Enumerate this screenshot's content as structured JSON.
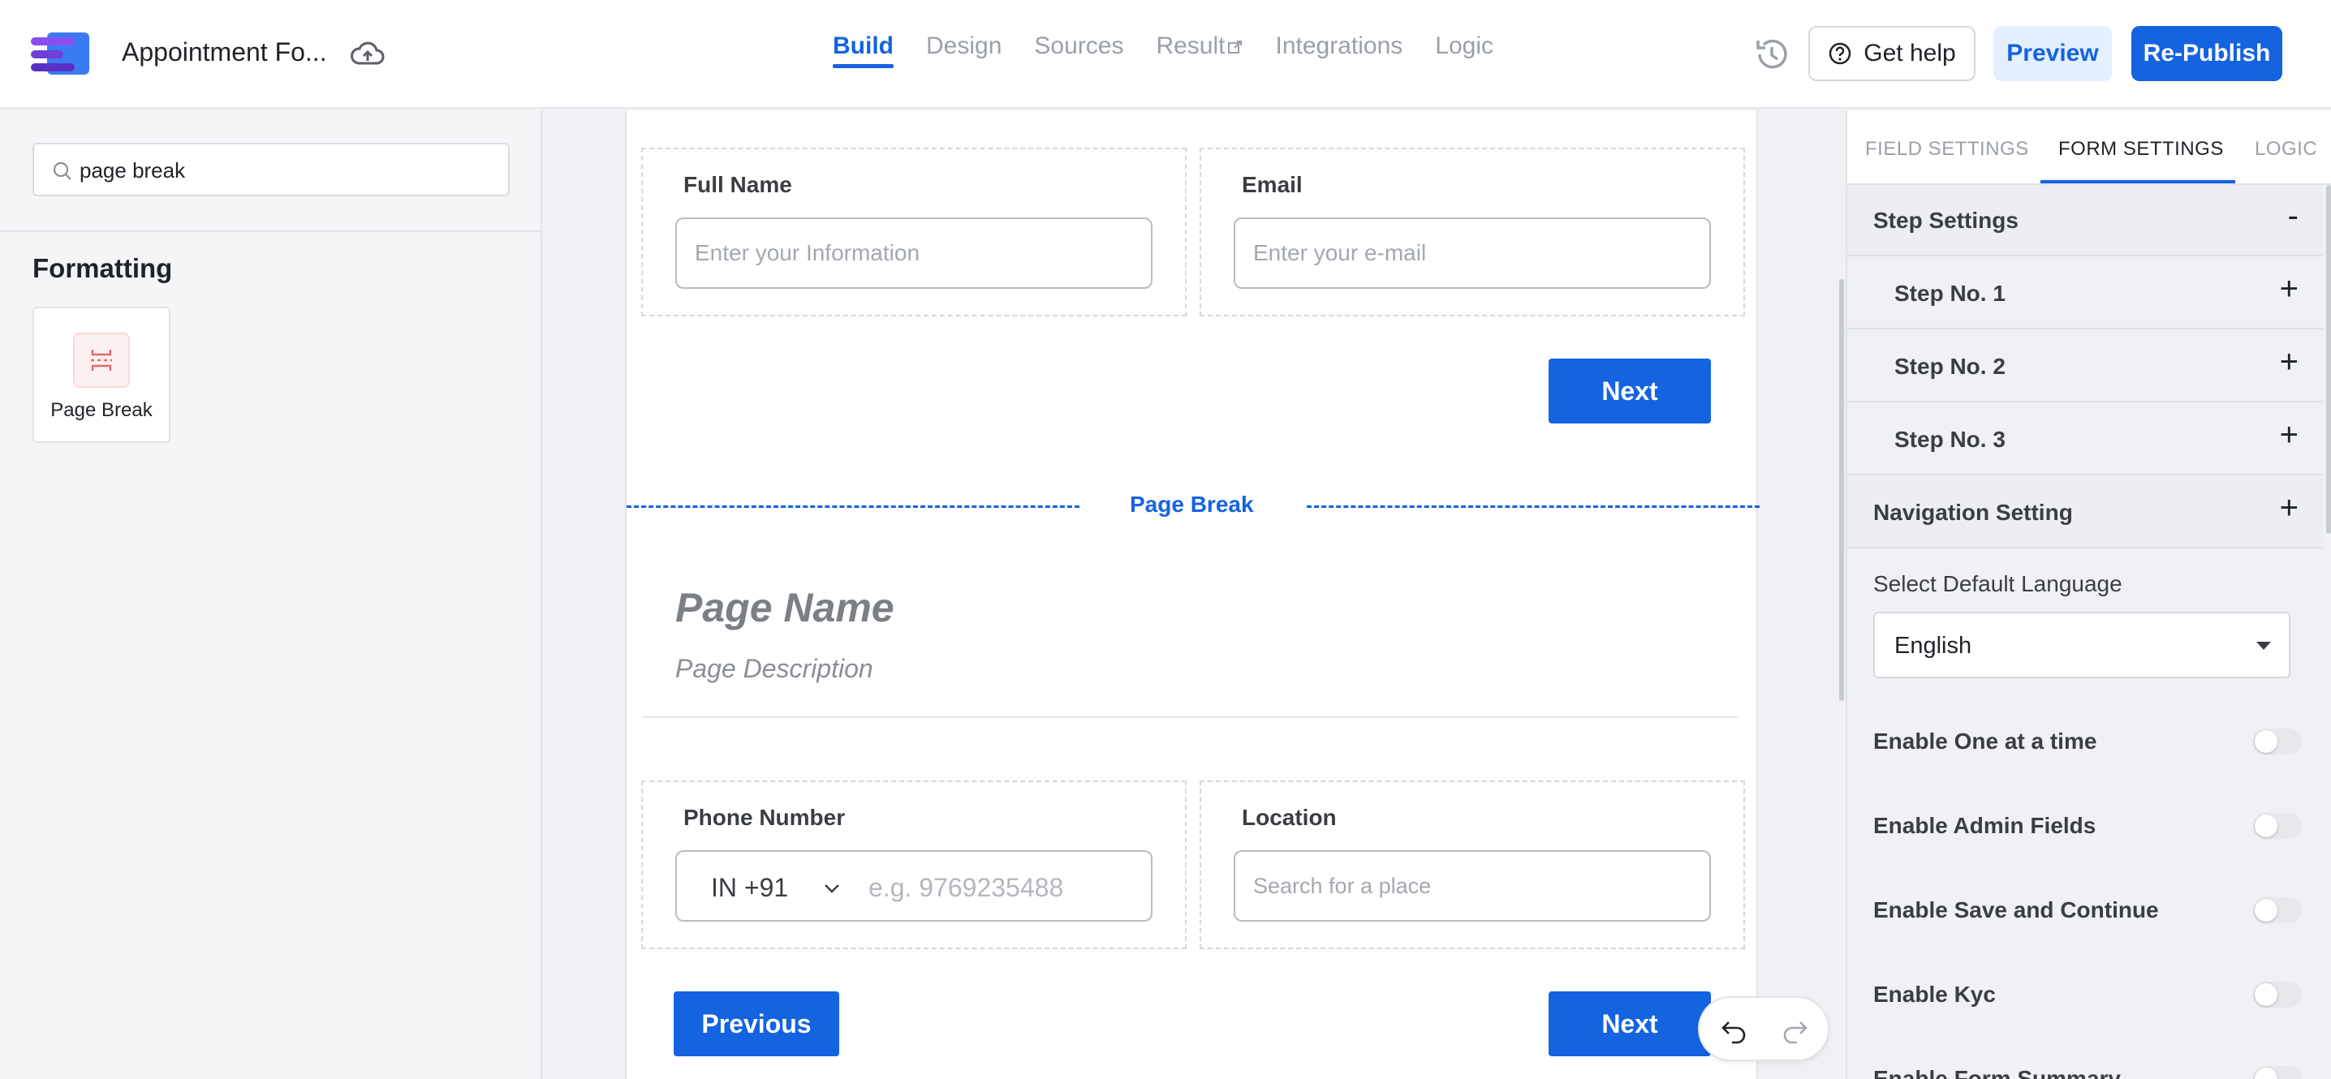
{
  "header": {
    "app_title": "Appointment Fo...",
    "nav": [
      {
        "label": "Build",
        "active": true
      },
      {
        "label": "Design",
        "active": false
      },
      {
        "label": "Sources",
        "active": false
      },
      {
        "label": "Result",
        "active": false,
        "external": true
      },
      {
        "label": "Integrations",
        "active": false
      },
      {
        "label": "Logic",
        "active": false
      }
    ],
    "help_label": "Get help",
    "preview_label": "Preview",
    "publish_label": "Re-Publish"
  },
  "left_panel": {
    "search_value": "page break",
    "section_title": "Formatting",
    "widget_label": "Page Break"
  },
  "canvas": {
    "step1": {
      "full_name_label": "Full Name",
      "full_name_placeholder": "Enter your Information",
      "email_label": "Email",
      "email_placeholder": "Enter your e-mail",
      "next_label": "Next"
    },
    "page_break_label": "Page Break",
    "page_name": "Page Name",
    "page_description": "Page Description",
    "step2": {
      "phone_label": "Phone Number",
      "country_code": "IN +91",
      "phone_placeholder": "e.g. 9769235488",
      "location_label": "Location",
      "location_placeholder": "Search for a place",
      "previous_label": "Previous",
      "next_label": "Next"
    }
  },
  "right_panel": {
    "tabs": [
      {
        "label": "FIELD SETTINGS",
        "active": false
      },
      {
        "label": "FORM SETTINGS",
        "active": true
      },
      {
        "label": "LOGIC",
        "active": false
      }
    ],
    "step_settings": {
      "label": "Step Settings",
      "sign": "-",
      "steps": [
        {
          "label": "Step No. 1",
          "sign": "+"
        },
        {
          "label": "Step No. 2",
          "sign": "+"
        },
        {
          "label": "Step No. 3",
          "sign": "+"
        }
      ]
    },
    "navigation_setting": {
      "label": "Navigation Setting",
      "sign": "+"
    },
    "language": {
      "label": "Select Default Language",
      "value": "English"
    },
    "toggles": [
      {
        "label": "Enable One at a time",
        "on": false
      },
      {
        "label": "Enable Admin Fields",
        "on": false
      },
      {
        "label": "Enable Save and Continue",
        "on": false
      },
      {
        "label": "Enable Kyc",
        "on": false
      },
      {
        "label": "Enable Form Summary",
        "on": false
      }
    ]
  },
  "colors": {
    "primary": "#1463e0",
    "primary_light": "#e4efff",
    "muted_text": "#9aa0a8",
    "page_break_icon": "#e06b6b"
  },
  "icons": {
    "logo": "form-builder-logo",
    "cloud": "cloud-icon",
    "history": "history-icon",
    "help": "question-circle-icon",
    "search": "search-icon",
    "page_break": "page-break-icon",
    "chevron": "chevron-down-icon",
    "caret": "caret-down-icon",
    "undo": "undo-icon",
    "redo": "redo-icon"
  }
}
